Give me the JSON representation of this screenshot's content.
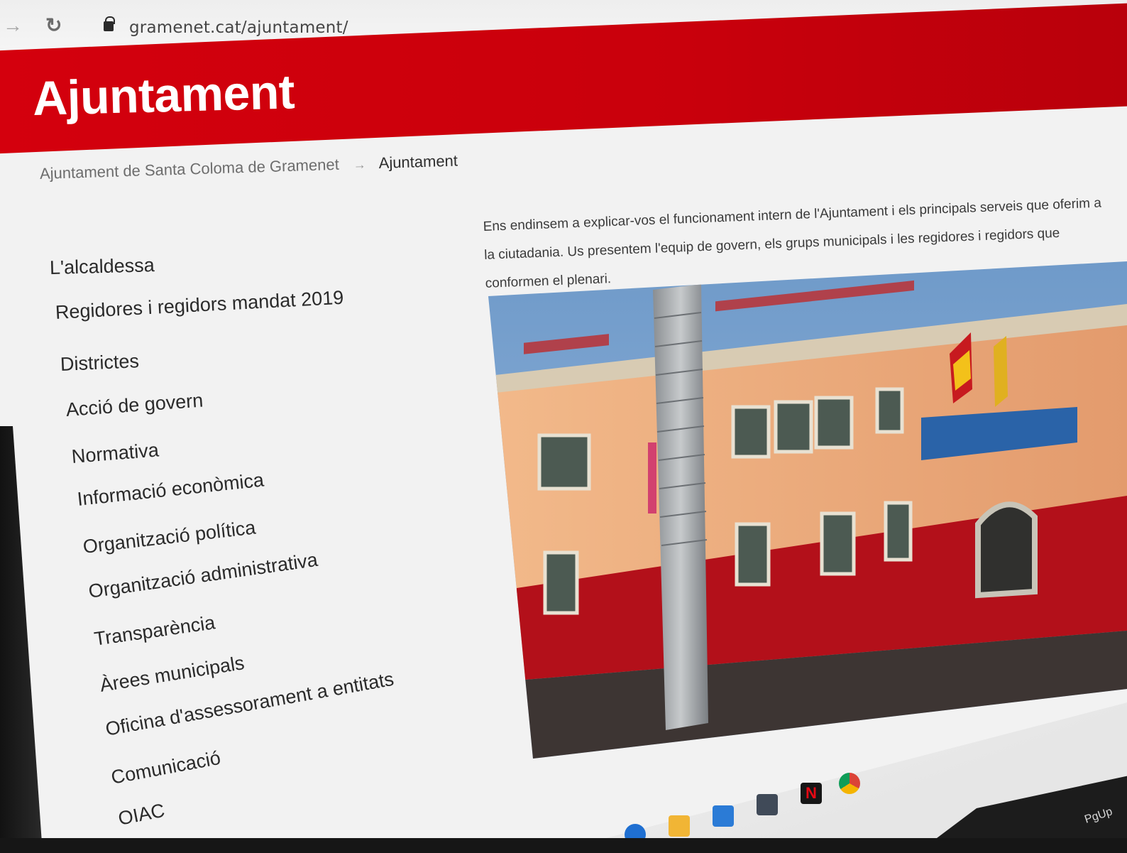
{
  "browser": {
    "url": "gramenet.cat/ajuntament/"
  },
  "header": {
    "title": "Ajuntament"
  },
  "breadcrumb": {
    "home": "Ajuntament de Santa Coloma de Gramenet",
    "separator": "→",
    "current": "Ajuntament"
  },
  "sidebar": {
    "items": [
      {
        "label": "L'alcaldessa"
      },
      {
        "label": "Regidores i regidors mandat 2019"
      },
      {
        "label": "Districtes"
      },
      {
        "label": "Acció de govern"
      },
      {
        "label": "Normativa"
      },
      {
        "label": "Informació econòmica"
      },
      {
        "label": "Organització política"
      },
      {
        "label": "Organització administrativa"
      },
      {
        "label": "Transparència"
      },
      {
        "label": "Àrees municipals"
      },
      {
        "label": "Oficina d'assessorament a entitats"
      },
      {
        "label": "Comunicació"
      },
      {
        "label": "OIAC"
      }
    ]
  },
  "main": {
    "intro": "Ens endinsem a explicar-vos el funcionament intern de l'Ajuntament i els principals serveis que oferim a la ciutadania. Us presentem l'equip de govern, els grups municipals i les regidores i regidors que conformen el plenari."
  },
  "keyboard": {
    "key": "PgUp"
  },
  "colors": {
    "brand_red": "#d4000d",
    "text_dark": "#2a2a2a"
  },
  "icons": [
    "forward-icon",
    "reload-icon",
    "lock-icon",
    "star-icon",
    "edge-icon",
    "folder-icon",
    "store-icon",
    "mail-icon",
    "netflix-icon",
    "chrome-icon"
  ]
}
